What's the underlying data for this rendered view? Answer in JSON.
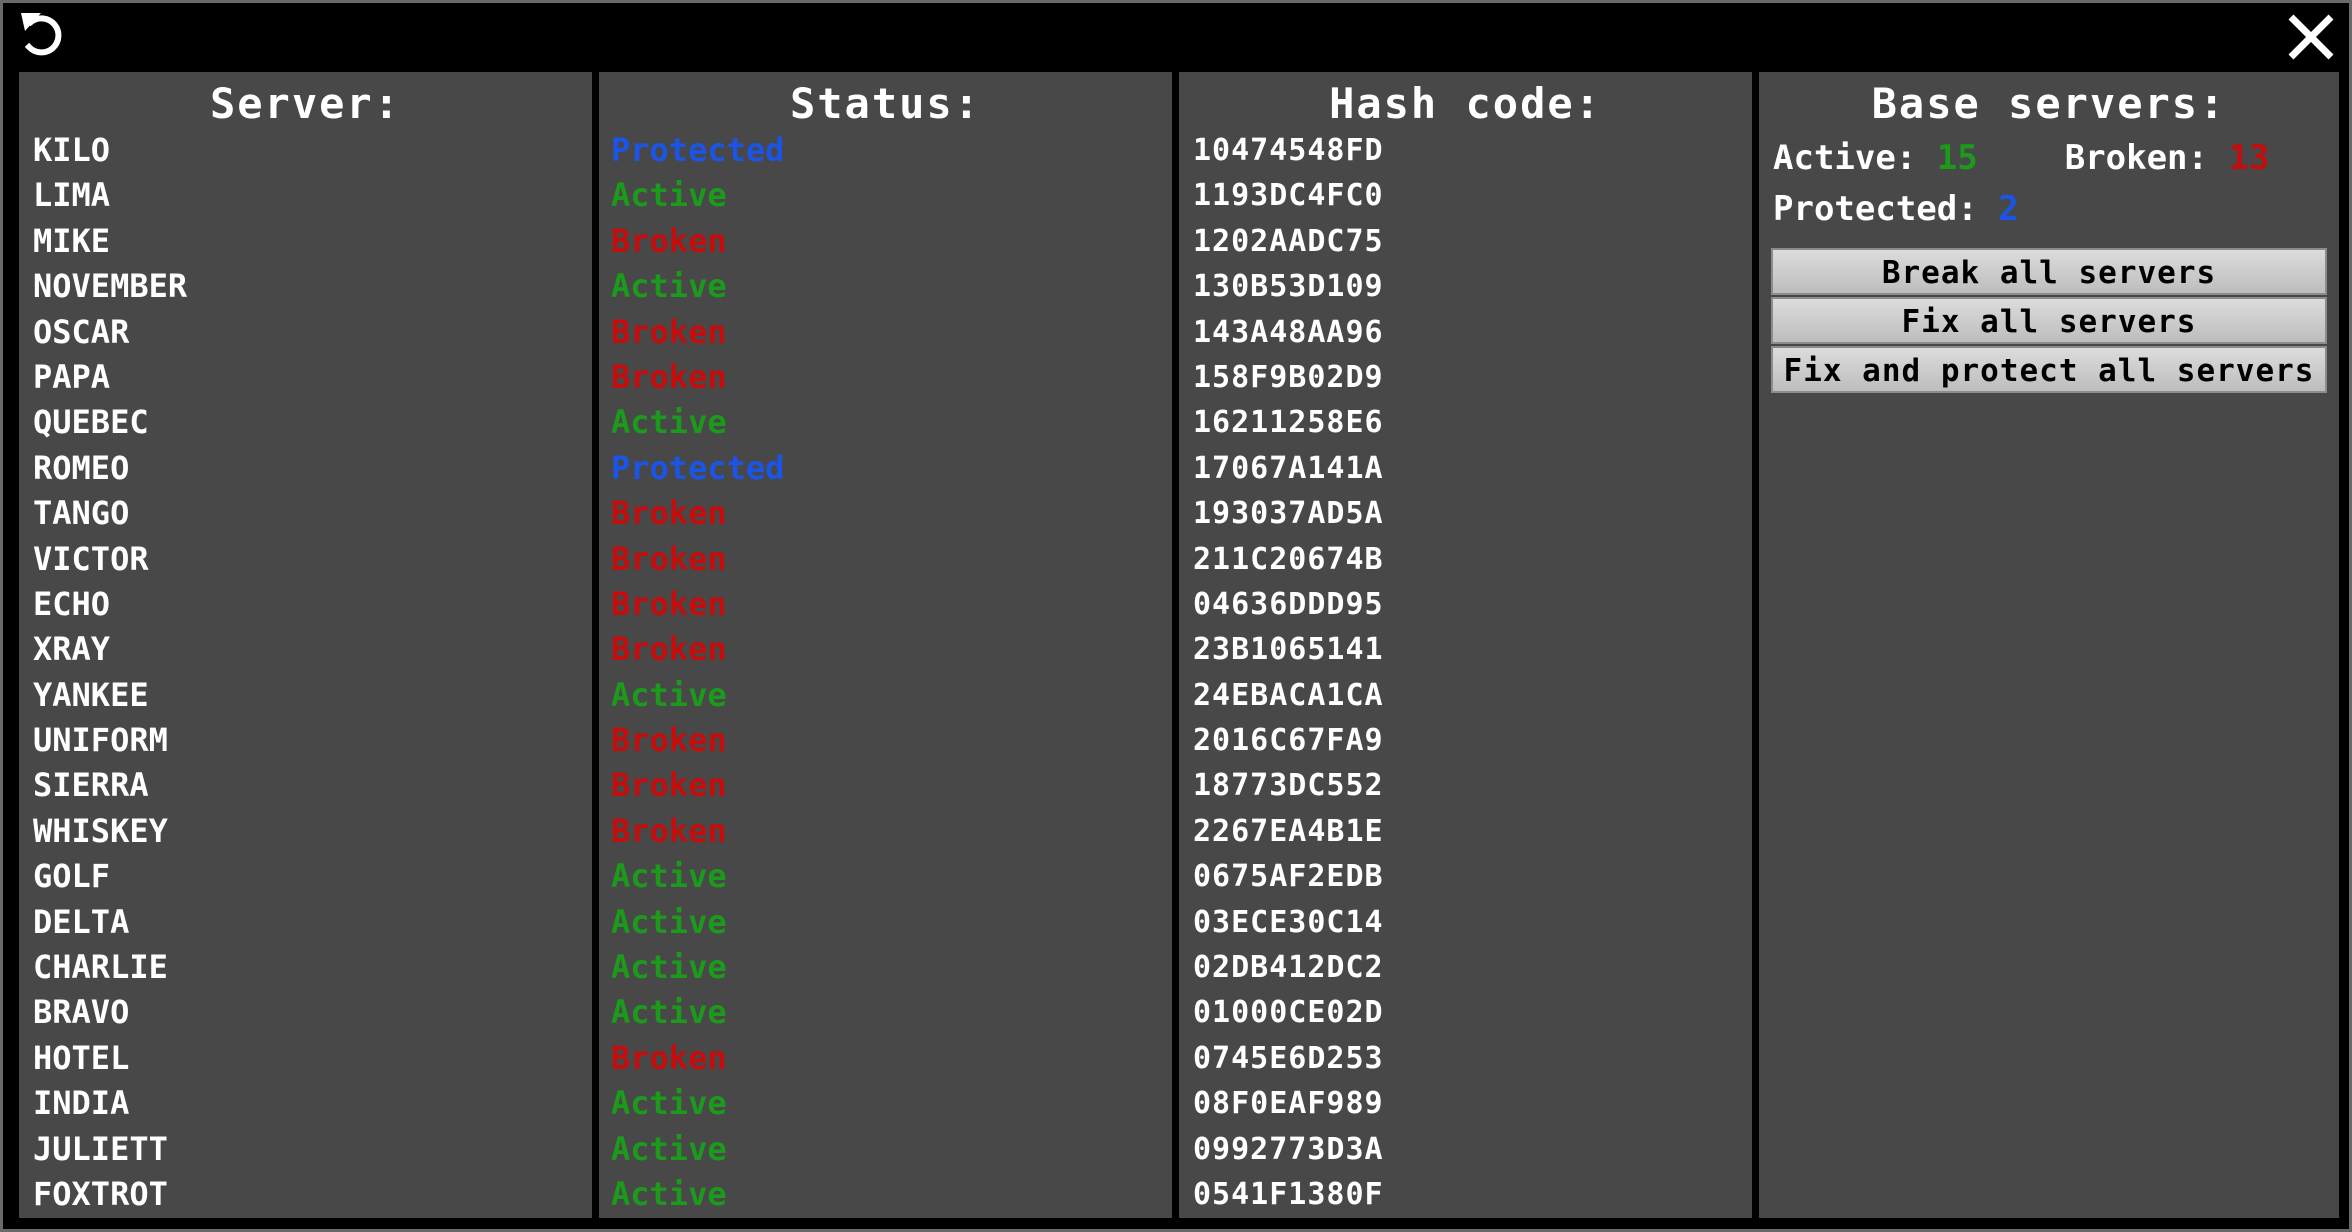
{
  "colors": {
    "Protected": "#1a55e8",
    "Active": "#1c9a1c",
    "Broken": "#c40d0d"
  },
  "icons": {
    "back": "back-arrow-icon",
    "close": "close-icon"
  },
  "servers_panel": {
    "title": "Server:"
  },
  "status_panel": {
    "title": "Status:"
  },
  "hash_panel": {
    "title": "Hash code:"
  },
  "base_panel": {
    "title": "Base servers:",
    "active_label": "Active:",
    "active_count": "15",
    "broken_label": "Broken:",
    "broken_count": "13",
    "protected_label": "Protected:",
    "protected_count": "2",
    "buttons": {
      "break_all": "Break all servers",
      "fix_all": "Fix all servers",
      "fix_protect_all": "Fix and protect all servers"
    }
  },
  "servers": [
    {
      "name": "KILO",
      "status": "Protected",
      "hash": "10474548FD"
    },
    {
      "name": "LIMA",
      "status": "Active",
      "hash": "1193DC4FC0"
    },
    {
      "name": "MIKE",
      "status": "Broken",
      "hash": "1202AADC75"
    },
    {
      "name": "NOVEMBER",
      "status": "Active",
      "hash": "130B53D109"
    },
    {
      "name": "OSCAR",
      "status": "Broken",
      "hash": "143A48AA96"
    },
    {
      "name": "PAPA",
      "status": "Broken",
      "hash": "158F9B02D9"
    },
    {
      "name": "QUEBEC",
      "status": "Active",
      "hash": "16211258E6"
    },
    {
      "name": "ROMEO",
      "status": "Protected",
      "hash": "17067A141A"
    },
    {
      "name": "TANGO",
      "status": "Broken",
      "hash": "193037AD5A"
    },
    {
      "name": "VICTOR",
      "status": "Broken",
      "hash": "211C20674B"
    },
    {
      "name": "ECHO",
      "status": "Broken",
      "hash": "04636DDD95"
    },
    {
      "name": "XRAY",
      "status": "Broken",
      "hash": "23B1065141"
    },
    {
      "name": "YANKEE",
      "status": "Active",
      "hash": "24EBACA1CA"
    },
    {
      "name": "UNIFORM",
      "status": "Broken",
      "hash": "2016C67FA9"
    },
    {
      "name": "SIERRA",
      "status": "Broken",
      "hash": "18773DC552"
    },
    {
      "name": "WHISKEY",
      "status": "Broken",
      "hash": "2267EA4B1E"
    },
    {
      "name": "GOLF",
      "status": "Active",
      "hash": "0675AF2EDB"
    },
    {
      "name": "DELTA",
      "status": "Active",
      "hash": "03ECE30C14"
    },
    {
      "name": "CHARLIE",
      "status": "Active",
      "hash": "02DB412DC2"
    },
    {
      "name": "BRAVO",
      "status": "Active",
      "hash": "01000CE02D"
    },
    {
      "name": "HOTEL",
      "status": "Broken",
      "hash": "0745E6D253"
    },
    {
      "name": "INDIA",
      "status": "Active",
      "hash": "08F0EAF989"
    },
    {
      "name": "JULIETT",
      "status": "Active",
      "hash": "0992773D3A"
    },
    {
      "name": "FOXTROT",
      "status": "Active",
      "hash": "0541F1380F"
    }
  ]
}
